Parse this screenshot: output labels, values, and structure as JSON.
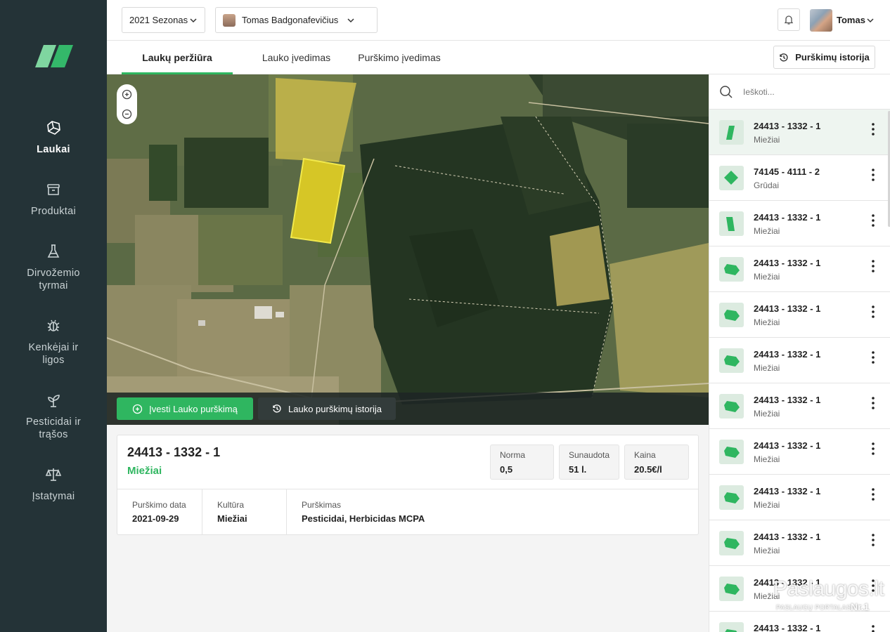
{
  "header": {
    "season": "2021 Sezonas",
    "farmer": "Tomas Badgonafevičius",
    "user_name": "Tomas"
  },
  "sidebar": {
    "items": [
      {
        "label": "Laukai",
        "icon": "field-icon",
        "active": true
      },
      {
        "label": "Produktai",
        "icon": "box-icon",
        "active": false
      },
      {
        "label": "Dirvožemio tyrmai",
        "icon": "flask-icon",
        "active": false
      },
      {
        "label": "Kenkėjai ir ligos",
        "icon": "bug-icon",
        "active": false
      },
      {
        "label": "Pesticidai ir trąšos",
        "icon": "sprout-icon",
        "active": false
      },
      {
        "label": "Įstatymai",
        "icon": "scales-icon",
        "active": false
      }
    ]
  },
  "tabs": {
    "items": [
      {
        "label": "Laukų peržiūra",
        "active": true
      },
      {
        "label": "Lauko įvedimas",
        "active": false
      },
      {
        "label": "Purškimo įvedimas",
        "active": false
      }
    ],
    "history_button": "Purškimų istorija"
  },
  "map": {
    "add_spraying_button": "Įvesti Lauko purškimą",
    "spraying_history_button": "Lauko purškimų istorija"
  },
  "field_card": {
    "title": "24413 - 1332 - 1",
    "crop": "Miežiai",
    "stats": [
      {
        "label": "Norma",
        "value": "0,5"
      },
      {
        "label": "Sunaudota",
        "value": "51 l."
      },
      {
        "label": "Kaina",
        "value": "20.5€/l"
      }
    ],
    "details": [
      {
        "label": "Purškimo data",
        "value": "2021-09-29"
      },
      {
        "label": "Kultūra",
        "value": "Miežiai"
      },
      {
        "label": "Purškimas",
        "value": "Pesticidai, Herbicidas MCPA"
      }
    ]
  },
  "search": {
    "placeholder": "Ieškoti..."
  },
  "fields": [
    {
      "name": "24413 - 1332 - 1",
      "crop": "Miežiai",
      "shape": "strip",
      "selected": true
    },
    {
      "name": "74145 - 4111 - 2",
      "crop": "Grūdai",
      "shape": "diamond",
      "selected": false
    },
    {
      "name": "24413 - 1332 - 1",
      "crop": "Miežiai",
      "shape": "strip2",
      "selected": false
    },
    {
      "name": "24413 - 1332 - 1",
      "crop": "Miežiai",
      "shape": "poly",
      "selected": false
    },
    {
      "name": "24413 - 1332 - 1",
      "crop": "Miežiai",
      "shape": "poly",
      "selected": false
    },
    {
      "name": "24413 - 1332 - 1",
      "crop": "Miežiai",
      "shape": "poly",
      "selected": false
    },
    {
      "name": "24413 - 1332 - 1",
      "crop": "Miežiai",
      "shape": "poly",
      "selected": false
    },
    {
      "name": "24413 - 1332 - 1",
      "crop": "Miežiai",
      "shape": "poly",
      "selected": false
    },
    {
      "name": "24413 - 1332 - 1",
      "crop": "Miežiai",
      "shape": "poly",
      "selected": false
    },
    {
      "name": "24413 - 1332 - 1",
      "crop": "Miežiai",
      "shape": "poly",
      "selected": false
    },
    {
      "name": "24413 - 1332 - 1",
      "crop": "Miežiai",
      "shape": "poly",
      "selected": false
    },
    {
      "name": "24413 - 1332 - 1",
      "crop": "",
      "shape": "poly",
      "selected": false
    }
  ],
  "watermark": {
    "main": "Paslaugos.lt",
    "sub": "PASLAUGŲ PORTALAS",
    "nr": "Nr.1"
  },
  "colors": {
    "sidebar": "#243337",
    "accent": "#2fb660",
    "selected_row": "#eef5f0"
  }
}
